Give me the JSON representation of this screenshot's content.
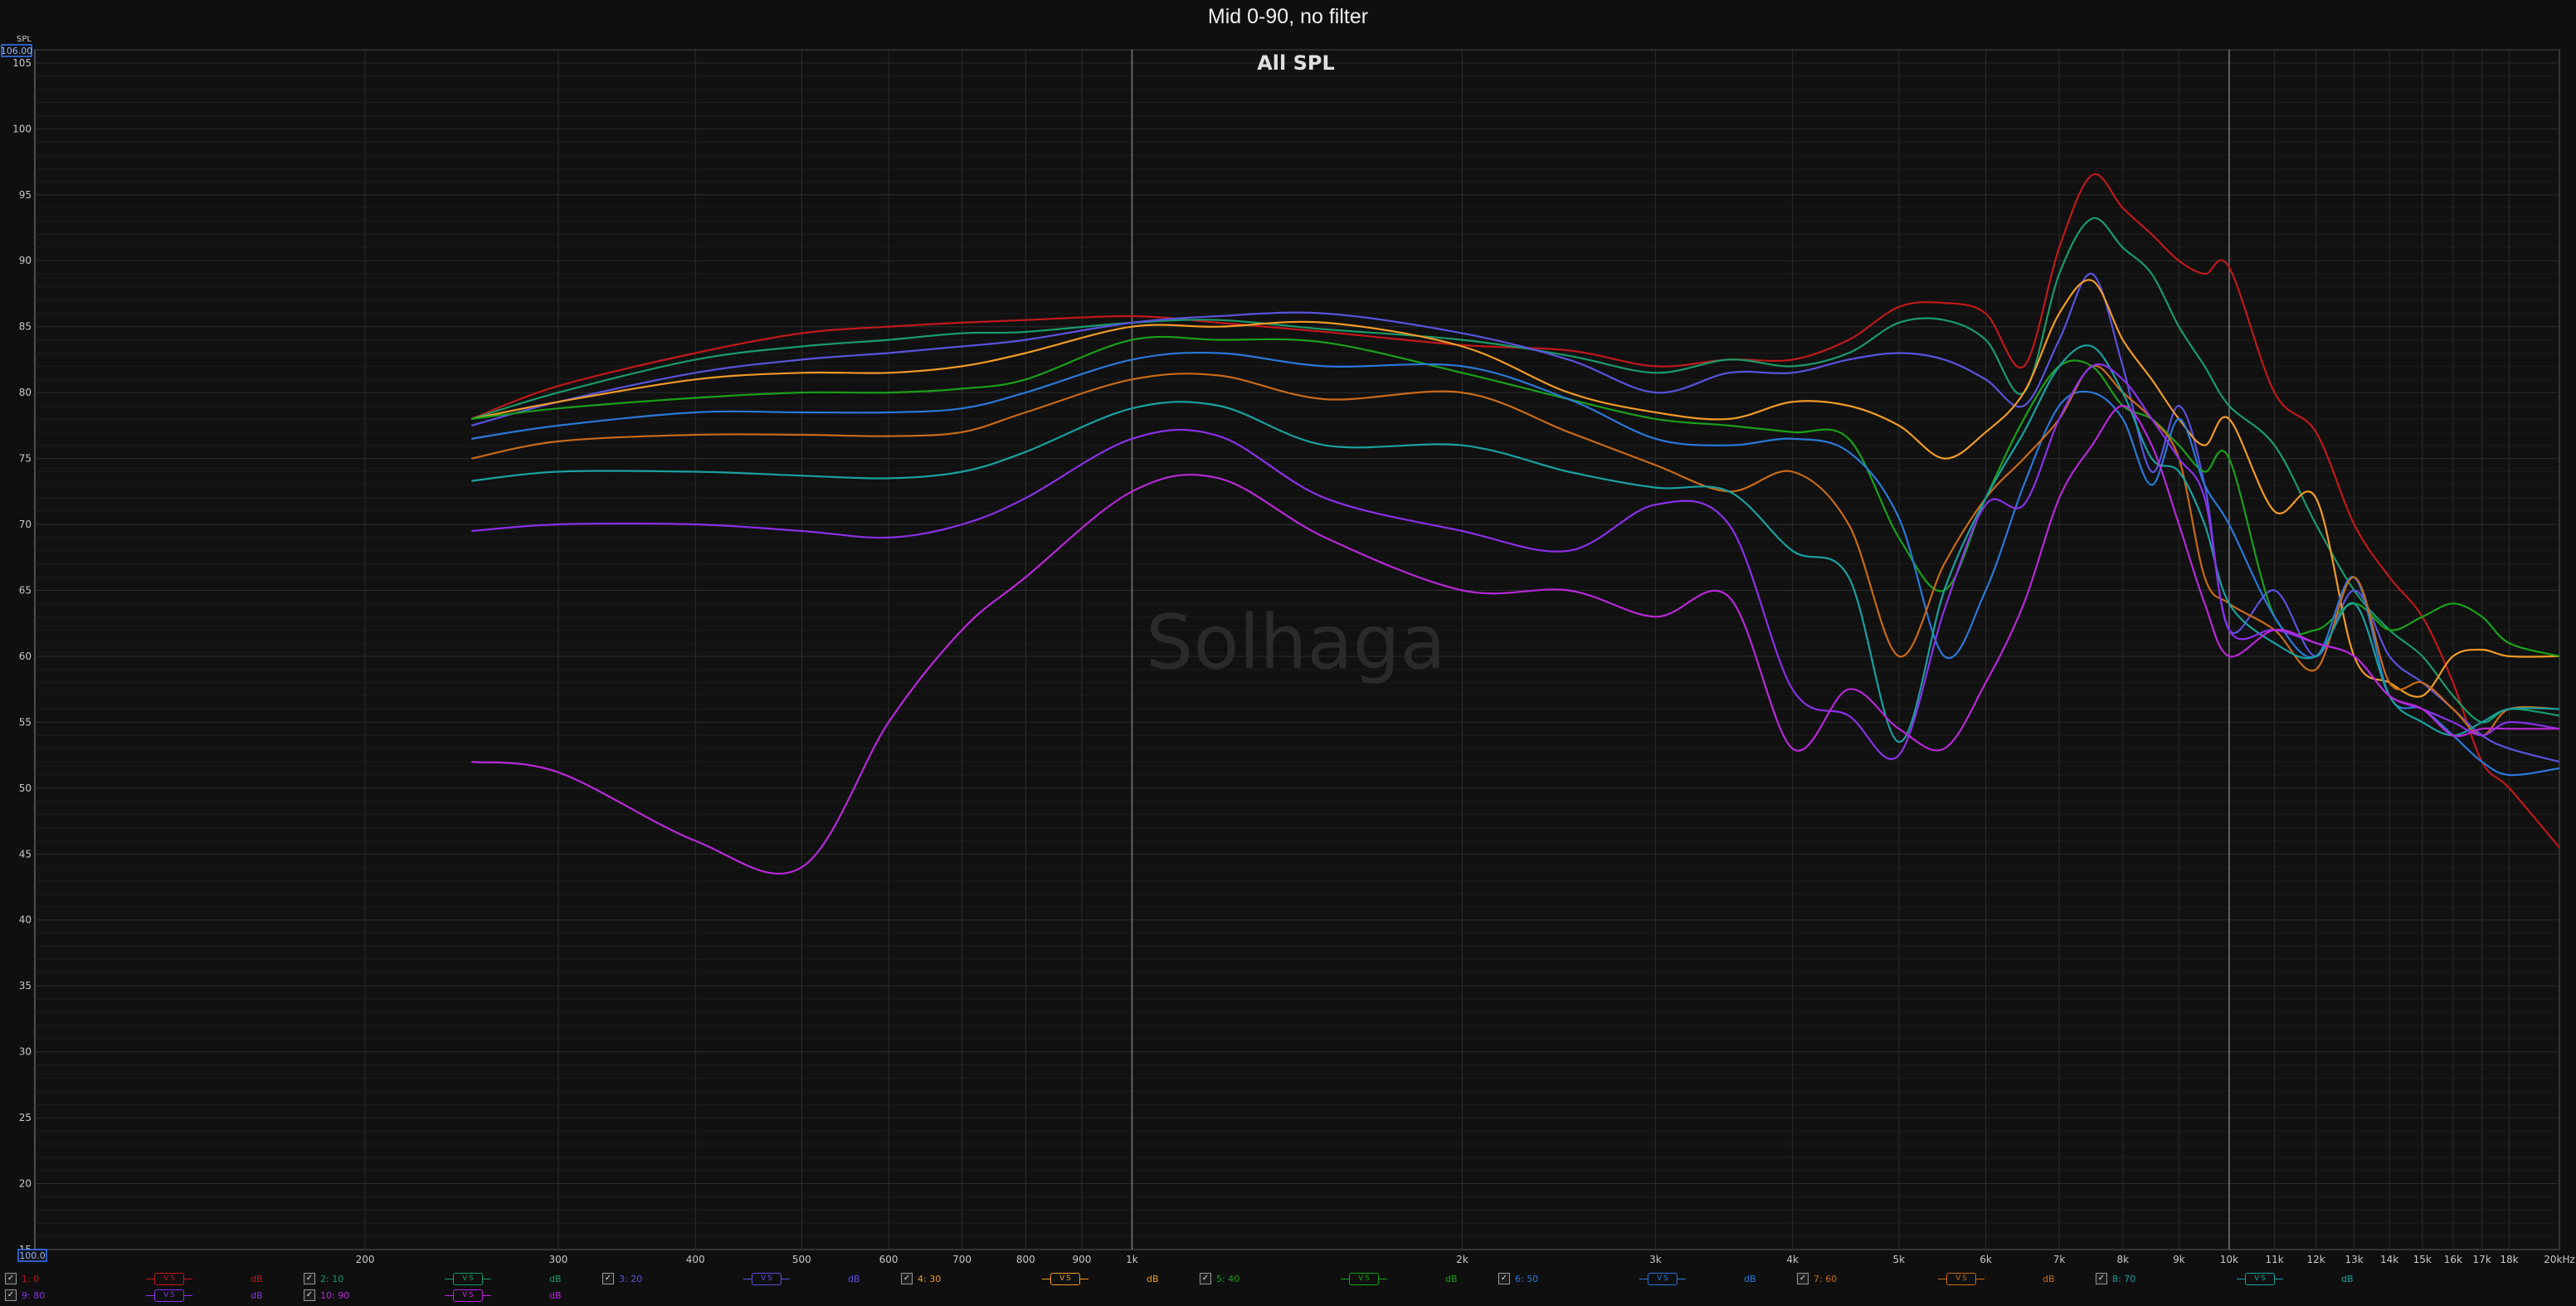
{
  "window": {
    "title": "Mid 0-90, no filter"
  },
  "watermark": "Solhaga",
  "axis_boxes": {
    "y_top": "106.00",
    "y_bottom": "100.0",
    "y_unit": "SPL"
  },
  "chart_data": {
    "type": "line",
    "title": "All SPL",
    "xlabel": "",
    "ylabel": "",
    "x_scale": "log",
    "xlim": [
      100,
      20000
    ],
    "ylim": [
      15,
      106
    ],
    "grid": true,
    "y_ticks": [
      15,
      20,
      25,
      30,
      35,
      40,
      45,
      50,
      55,
      60,
      65,
      70,
      75,
      80,
      85,
      90,
      95,
      100,
      105
    ],
    "x_ticks": [
      {
        "v": 200,
        "label": "200"
      },
      {
        "v": 300,
        "label": "300"
      },
      {
        "v": 400,
        "label": "400"
      },
      {
        "v": 500,
        "label": "500"
      },
      {
        "v": 600,
        "label": "600"
      },
      {
        "v": 700,
        "label": "700"
      },
      {
        "v": 800,
        "label": "800"
      },
      {
        "v": 900,
        "label": "900"
      },
      {
        "v": 1000,
        "label": "1k"
      },
      {
        "v": 2000,
        "label": "2k"
      },
      {
        "v": 3000,
        "label": "3k"
      },
      {
        "v": 4000,
        "label": "4k"
      },
      {
        "v": 5000,
        "label": "5k"
      },
      {
        "v": 6000,
        "label": "6k"
      },
      {
        "v": 7000,
        "label": "7k"
      },
      {
        "v": 8000,
        "label": "8k"
      },
      {
        "v": 9000,
        "label": "9k"
      },
      {
        "v": 10000,
        "label": "10k"
      },
      {
        "v": 11000,
        "label": "11k"
      },
      {
        "v": 12000,
        "label": "12k"
      },
      {
        "v": 13000,
        "label": "13k"
      },
      {
        "v": 14000,
        "label": "14k"
      },
      {
        "v": 15000,
        "label": "15k"
      },
      {
        "v": 16000,
        "label": "16k"
      },
      {
        "v": 17000,
        "label": "17k"
      },
      {
        "v": 18000,
        "label": "18k"
      },
      {
        "v": 20000,
        "label": "20kHz"
      }
    ],
    "x": [
      250,
      300,
      400,
      500,
      600,
      700,
      800,
      1000,
      1200,
      1500,
      2000,
      2500,
      3000,
      3500,
      4000,
      4500,
      5000,
      5500,
      6000,
      6500,
      7000,
      7500,
      8000,
      8500,
      9000,
      9500,
      10000,
      11000,
      12000,
      13000,
      14000,
      15000,
      16000,
      17000,
      18000,
      20000
    ],
    "series": [
      {
        "name": "1: 0",
        "color": "#c0191b",
        "values": [
          78,
          80.5,
          83,
          84.5,
          85,
          85.3,
          85.5,
          85.8,
          85.3,
          84.6,
          83.6,
          83.2,
          82,
          82.5,
          82.5,
          84,
          86.5,
          86.8,
          86,
          82,
          91,
          96.5,
          94,
          92,
          90,
          89,
          89.5,
          80,
          77,
          70,
          66,
          63,
          58,
          52,
          50,
          45.5
        ]
      },
      {
        "name": "2: 10",
        "color": "#1a9a6a",
        "values": [
          78,
          80,
          82.5,
          83.5,
          84,
          84.5,
          84.6,
          85.3,
          85.5,
          84.8,
          84,
          82.8,
          81.5,
          82.5,
          82,
          83,
          85.3,
          85.5,
          84,
          80,
          89,
          93.2,
          91,
          89,
          85,
          82,
          79,
          76,
          70,
          65,
          62,
          60,
          57,
          55,
          56,
          55.5
        ]
      },
      {
        "name": "3: 20",
        "color": "#5a52dd",
        "values": [
          77.5,
          79.3,
          81.5,
          82.5,
          83,
          83.5,
          84,
          85.3,
          85.8,
          86,
          84.5,
          82.5,
          80,
          81.5,
          81.5,
          82.5,
          83,
          82.5,
          81,
          79,
          84,
          89,
          82,
          74,
          79,
          73,
          62,
          65,
          60,
          65,
          60,
          58,
          56,
          54,
          53,
          52
        ]
      },
      {
        "name": "4: 30",
        "color": "#f09a28",
        "values": [
          78,
          79.3,
          81,
          81.5,
          81.5,
          82,
          83,
          85,
          85,
          85.3,
          83.5,
          80,
          78.5,
          78,
          79.3,
          79,
          77.5,
          75,
          77,
          80,
          86,
          88.5,
          84,
          81,
          78,
          76,
          78,
          71,
          72,
          60,
          58,
          57,
          60,
          60.5,
          60,
          60
        ]
      },
      {
        "name": "5: 40",
        "color": "#1aa01a",
        "values": [
          78,
          78.8,
          79.6,
          80,
          80,
          80.3,
          81,
          84,
          84,
          83.8,
          81.5,
          79.5,
          78,
          77.5,
          77,
          76.5,
          69,
          65,
          72,
          78,
          82,
          82,
          79,
          78,
          76,
          74,
          75,
          63,
          62,
          64,
          62,
          63,
          64,
          63,
          61,
          60
        ]
      },
      {
        "name": "6: 50",
        "color": "#2a78d8",
        "values": [
          76.5,
          77.5,
          78.5,
          78.5,
          78.5,
          78.8,
          80,
          82.5,
          83,
          82,
          82,
          79.5,
          76.5,
          76,
          76.5,
          75.5,
          70.5,
          60,
          65,
          73,
          79,
          80,
          78,
          73,
          78,
          73,
          70,
          63,
          60,
          66,
          57,
          56,
          54,
          52,
          51,
          51.5
        ]
      },
      {
        "name": "7: 60",
        "color": "#c86a1a",
        "values": [
          75,
          76.3,
          76.8,
          76.8,
          76.7,
          77,
          78.5,
          81,
          81.3,
          79.5,
          80,
          77,
          74.5,
          72.5,
          74,
          70,
          60,
          67,
          72,
          75,
          78,
          82,
          80,
          78,
          75,
          66,
          64,
          62,
          59,
          66,
          58,
          58,
          56,
          54,
          56,
          56
        ]
      },
      {
        "name": "8: 70",
        "color": "#1aa0a0",
        "values": [
          73.3,
          74,
          74,
          73.7,
          73.5,
          74,
          75.5,
          78.8,
          79,
          76,
          76,
          74,
          72.8,
          72.5,
          68,
          66,
          53.5,
          65,
          72,
          77,
          82,
          83.5,
          80,
          75,
          74,
          70,
          64,
          61,
          60,
          64,
          57,
          55,
          54,
          55,
          56,
          56
        ]
      },
      {
        "name": "9: 80",
        "color": "#8a30e8",
        "values": [
          69.5,
          70,
          70,
          69.5,
          69,
          70,
          72,
          76.5,
          76.7,
          72,
          69.5,
          68,
          71.5,
          70,
          57.5,
          55.5,
          52.5,
          63.5,
          71.5,
          71.5,
          78,
          82,
          81,
          78,
          75,
          72,
          62,
          62,
          61,
          60,
          57,
          56,
          55,
          54,
          55,
          54.5
        ]
      },
      {
        "name": "10: 90",
        "color": "#b828d8",
        "values": [
          52,
          51.2,
          46,
          44,
          55,
          62,
          66,
          72.5,
          73.5,
          69,
          65,
          65,
          63,
          64.5,
          53,
          57.5,
          54.5,
          53,
          58,
          64,
          72,
          76,
          79,
          76,
          70,
          64,
          60,
          62,
          61,
          60,
          57,
          56,
          54,
          54.5,
          54.5,
          54.5
        ]
      }
    ]
  }
}
